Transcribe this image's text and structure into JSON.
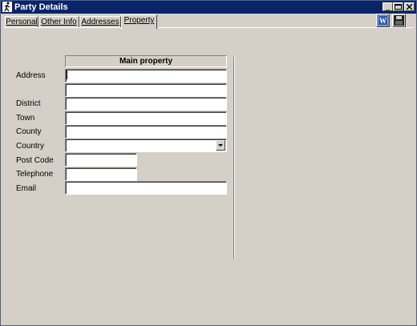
{
  "window": {
    "title": "Party Details"
  },
  "tabs": [
    {
      "label": "Personal"
    },
    {
      "label": "Other Info"
    },
    {
      "label": "Addresses"
    },
    {
      "label": "Property",
      "active": true
    }
  ],
  "toolbar": {
    "word_icon": "word-document-icon",
    "save_icon": "floppy-save-icon"
  },
  "form": {
    "header": "Main property",
    "labels": {
      "address": "Address",
      "district": "District",
      "town": "Town",
      "county": "County",
      "country": "Country",
      "post_code": "Post Code",
      "telephone": "Telephone",
      "email": "Email"
    },
    "values": {
      "address_line1": "",
      "address_line2": "",
      "district": "",
      "town": "",
      "county": "",
      "country": "",
      "post_code": "",
      "telephone": "",
      "email": ""
    }
  },
  "colors": {
    "titlebar": "#0a246a",
    "face": "#d4d0c8"
  }
}
